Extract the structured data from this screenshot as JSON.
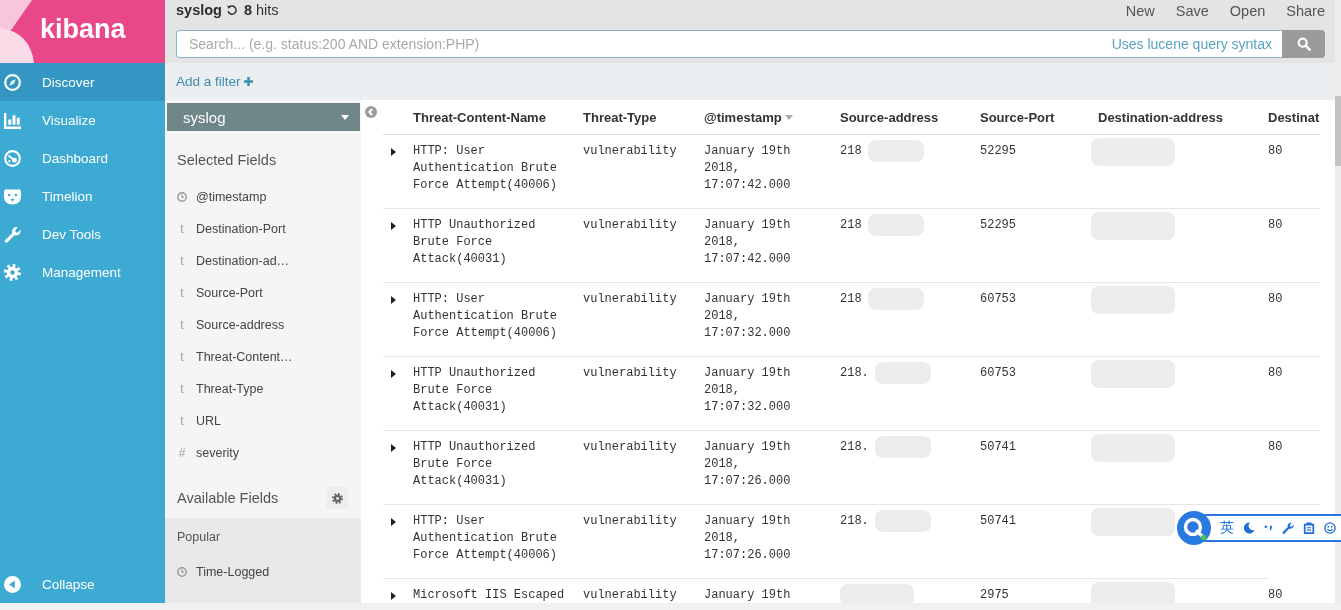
{
  "nav": {
    "logo": "kibana",
    "items": [
      {
        "label": "Discover",
        "selected": true
      },
      {
        "label": "Visualize",
        "selected": false
      },
      {
        "label": "Dashboard",
        "selected": false
      },
      {
        "label": "Timelion",
        "selected": false
      },
      {
        "label": "Dev Tools",
        "selected": false
      },
      {
        "label": "Management",
        "selected": false
      }
    ],
    "collapse": "Collapse"
  },
  "header": {
    "index": "syslog",
    "hits_count": "8",
    "hits_label": "hits",
    "menu": [
      "New",
      "Save",
      "Open",
      "Share"
    ]
  },
  "search": {
    "placeholder": "Search... (e.g. status:200 AND extension:PHP)",
    "syntax_link": "Uses lucene query syntax"
  },
  "filter_bar": {
    "add_filter": "Add a filter"
  },
  "sidebar": {
    "index_pattern": "syslog",
    "selected_title": "Selected Fields",
    "selected_fields": [
      {
        "kind": "date",
        "name": "@timestamp"
      },
      {
        "kind": "text",
        "type_label": "t",
        "name": "Destination-Port"
      },
      {
        "kind": "text",
        "type_label": "t",
        "name": "Destination-ad…"
      },
      {
        "kind": "text",
        "type_label": "t",
        "name": "Source-Port"
      },
      {
        "kind": "text",
        "type_label": "t",
        "name": "Source-address"
      },
      {
        "kind": "text",
        "type_label": "t",
        "name": "Threat-Content…"
      },
      {
        "kind": "text",
        "type_label": "t",
        "name": "Threat-Type"
      },
      {
        "kind": "text",
        "type_label": "t",
        "name": "URL"
      },
      {
        "kind": "number",
        "type_label": "#",
        "name": "severity"
      }
    ],
    "available_title": "Available Fields",
    "popular_title": "Popular",
    "popular_fields": [
      {
        "kind": "date",
        "name": "Time-Logged"
      }
    ]
  },
  "table": {
    "columns": [
      {
        "label": "Threat-Content-Name",
        "sorted": false
      },
      {
        "label": "Threat-Type",
        "sorted": false
      },
      {
        "label": "@timestamp",
        "sorted": true
      },
      {
        "label": "Source-address",
        "sorted": false
      },
      {
        "label": "Source-Port",
        "sorted": false
      },
      {
        "label": "Destination-address",
        "sorted": false
      },
      {
        "label": "Destinat",
        "sorted": false
      }
    ],
    "rows": [
      {
        "expanded": false,
        "cells": [
          {
            "text": "HTTP: User Authentication Brute Force Attempt(40006)",
            "blurred": false
          },
          {
            "text": "vulnerability",
            "blurred": false
          },
          {
            "text": "January 19th 2018, 17:07:42.000",
            "blurred": false
          },
          {
            "text": "218",
            "blurred": true
          },
          {
            "text": "52295",
            "blurred": false
          },
          {
            "blurred": true
          },
          {
            "text": "80",
            "blurred": false
          }
        ]
      },
      {
        "expanded": false,
        "cells": [
          {
            "text": "HTTP Unauthorized Brute Force Attack(40031)",
            "blurred": false
          },
          {
            "text": "vulnerability",
            "blurred": false
          },
          {
            "text": "January 19th 2018, 17:07:42.000",
            "blurred": false
          },
          {
            "text": "218",
            "blurred": true
          },
          {
            "text": "52295",
            "blurred": false
          },
          {
            "blurred": true
          },
          {
            "text": "80",
            "blurred": false
          }
        ]
      },
      {
        "expanded": false,
        "cells": [
          {
            "text": "HTTP: User Authentication Brute Force Attempt(40006)",
            "blurred": false
          },
          {
            "text": "vulnerability",
            "blurred": false
          },
          {
            "text": "January 19th 2018, 17:07:32.000",
            "blurred": false
          },
          {
            "text": "218",
            "blurred": true
          },
          {
            "text": "60753",
            "blurred": false
          },
          {
            "blurred": true
          },
          {
            "text": "80",
            "blurred": false
          }
        ]
      },
      {
        "expanded": false,
        "cells": [
          {
            "text": "HTTP Unauthorized Brute Force Attack(40031)",
            "blurred": false
          },
          {
            "text": "vulnerability",
            "blurred": false
          },
          {
            "text": "January 19th 2018, 17:07:32.000",
            "blurred": false
          },
          {
            "text": "218.",
            "blurred": true
          },
          {
            "text": "60753",
            "blurred": false
          },
          {
            "blurred": true
          },
          {
            "text": "80",
            "blurred": false
          }
        ]
      },
      {
        "expanded": false,
        "cells": [
          {
            "text": "HTTP Unauthorized Brute Force Attack(40031)",
            "blurred": false
          },
          {
            "text": "vulnerability",
            "blurred": false
          },
          {
            "text": "January 19th 2018, 17:07:26.000",
            "blurred": false
          },
          {
            "text": "218.",
            "blurred": true
          },
          {
            "text": "50741",
            "blurred": false
          },
          {
            "blurred": true
          },
          {
            "text": "80",
            "blurred": false
          }
        ]
      },
      {
        "expanded": false,
        "cells": [
          {
            "text": "HTTP: User Authentication Brute Force Attempt(40006)",
            "blurred": false
          },
          {
            "text": "vulnerability",
            "blurred": false
          },
          {
            "text": "January 19th 2018, 17:07:26.000",
            "blurred": false
          },
          {
            "text": "218.",
            "blurred": true
          },
          {
            "text": "50741",
            "blurred": false
          },
          {
            "blurred": true
          }
        ]
      },
      {
        "expanded": false,
        "cells": [
          {
            "text": "Microsoft IIS Escaped",
            "blurred": false
          },
          {
            "text": "vulnerability",
            "blurred": false
          },
          {
            "text": "January 19th",
            "blurred": false
          },
          {
            "blurred": true
          },
          {
            "text": "2975",
            "blurred": false
          },
          {
            "blurred": true
          },
          {
            "text": "80",
            "blurred": false
          }
        ]
      }
    ]
  },
  "ime_toolbar": {
    "mode": "英"
  }
}
